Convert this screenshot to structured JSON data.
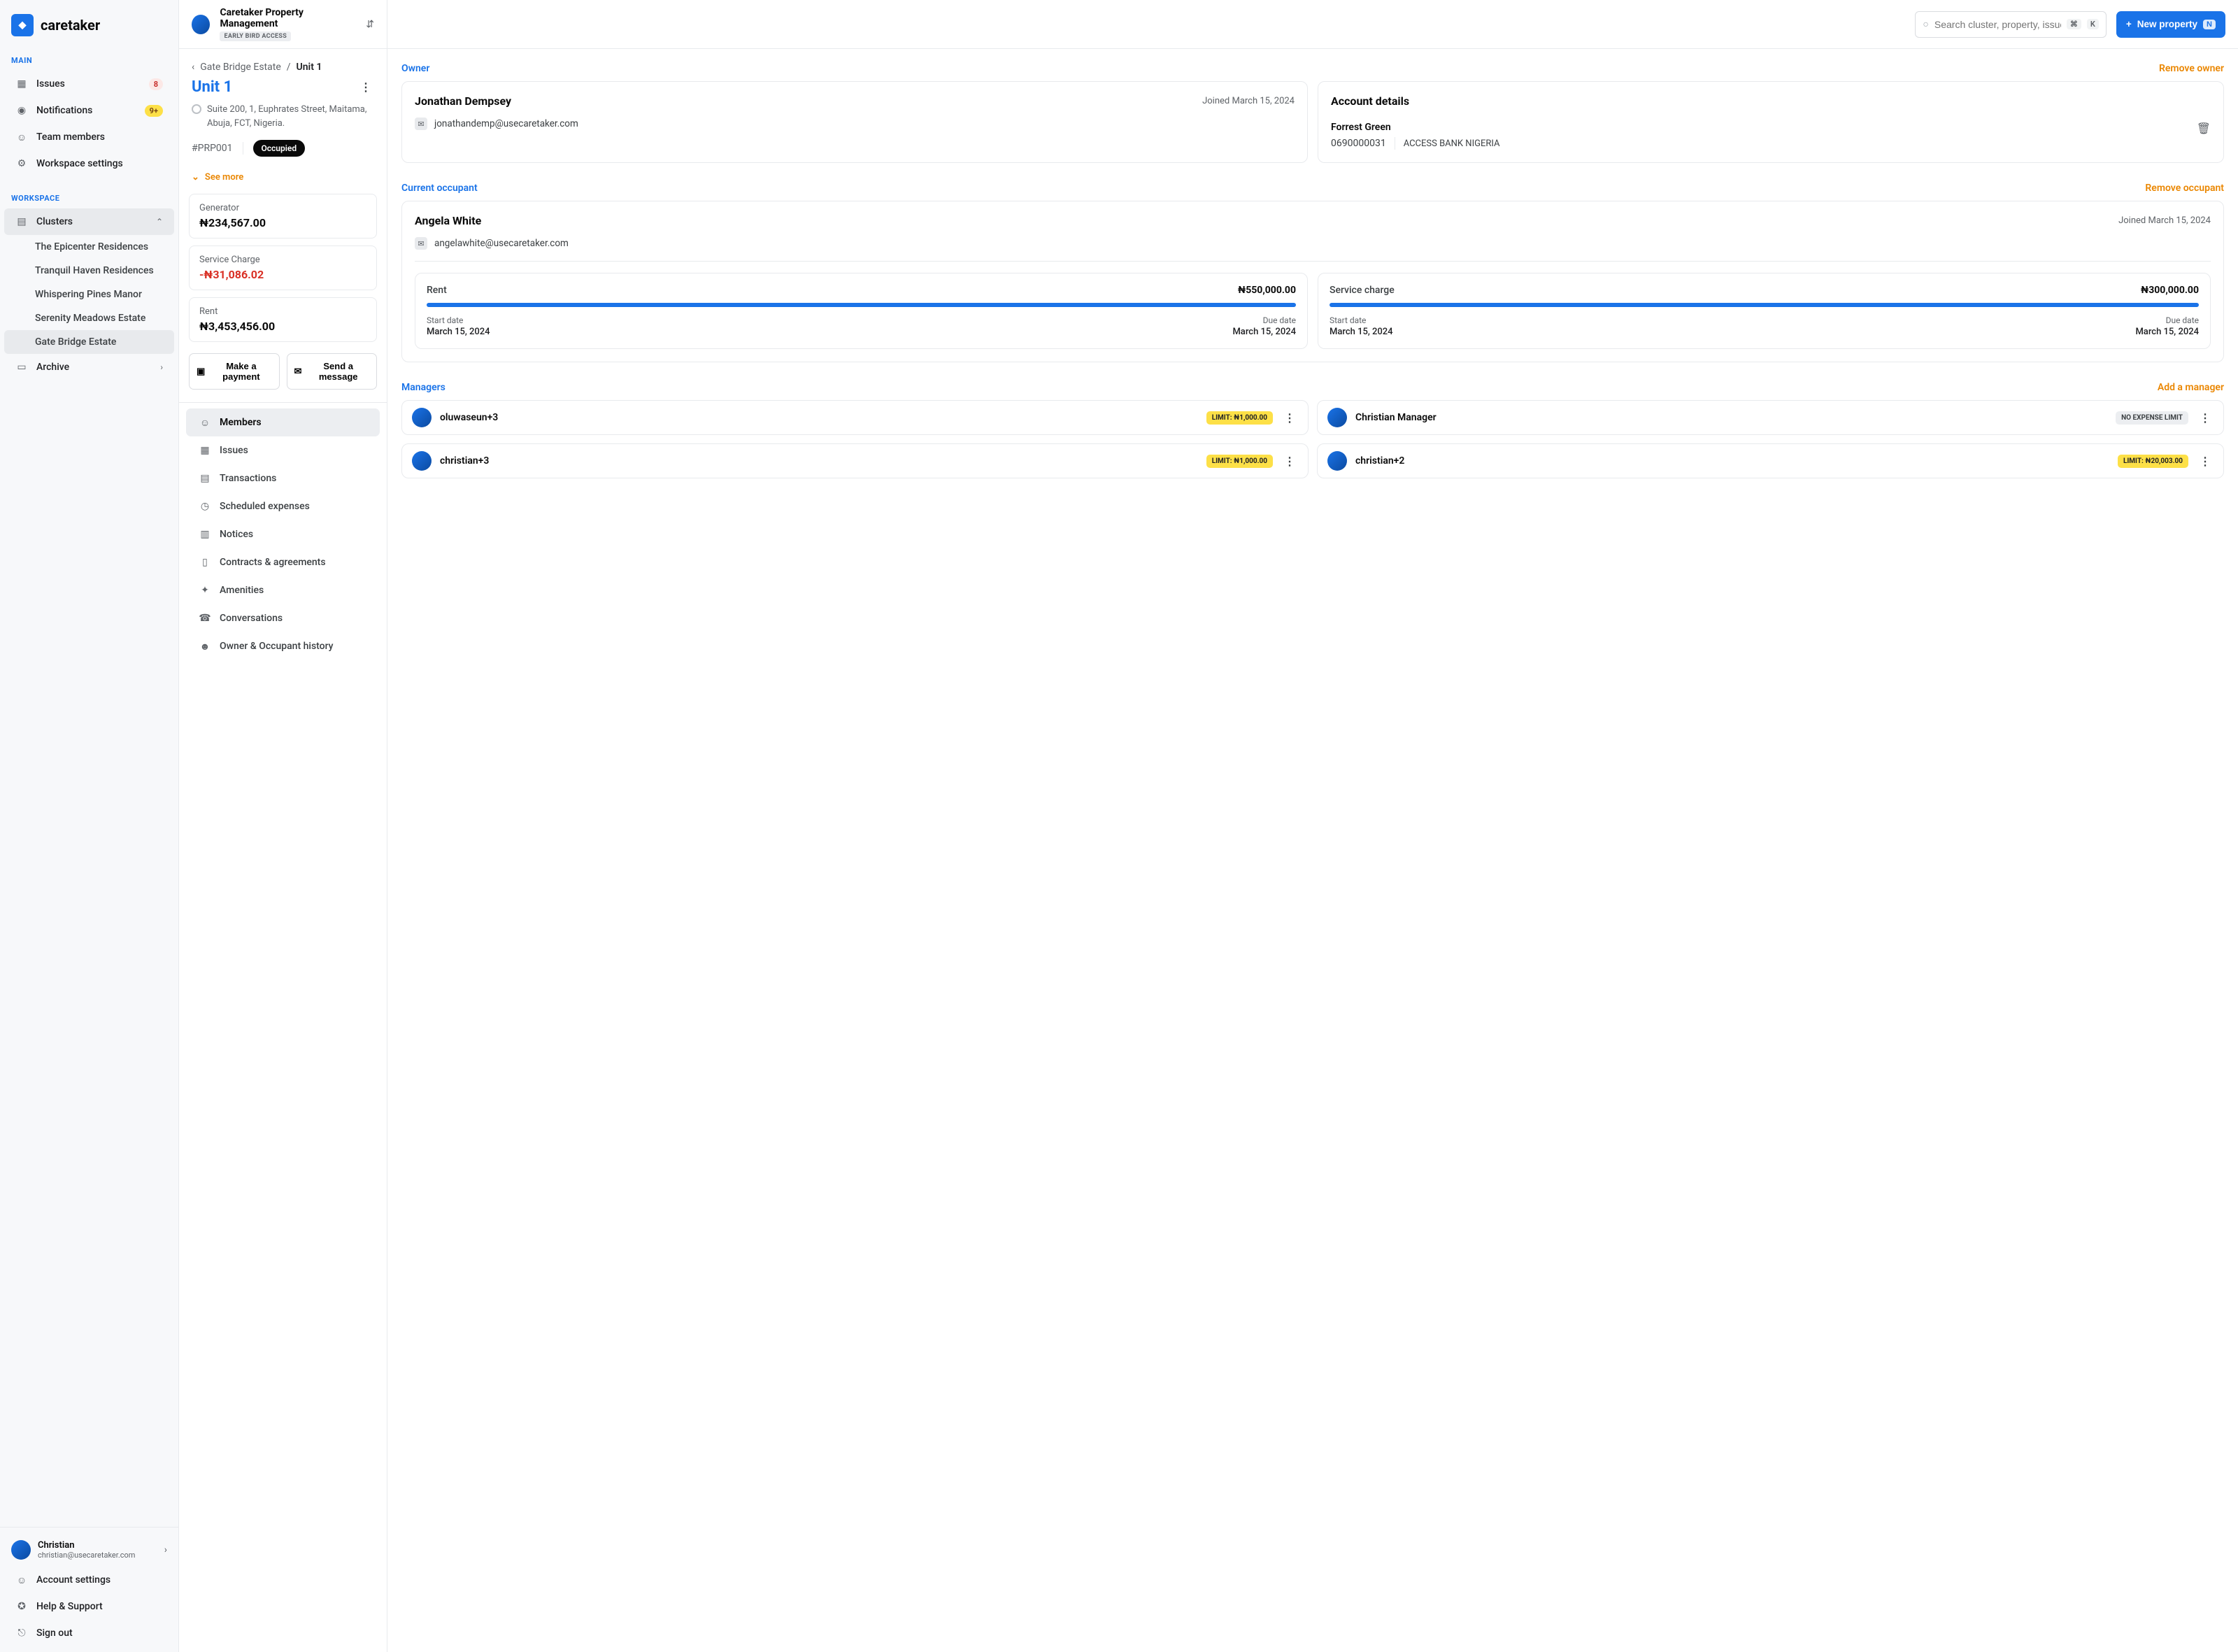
{
  "brand": "caretaker",
  "sidebar": {
    "main_label": "MAIN",
    "workspace_label": "WORKSPACE",
    "items_main": [
      {
        "label": "Issues",
        "badge": "8",
        "badgeClass": "badge-red"
      },
      {
        "label": "Notifications",
        "badge": "9+",
        "badgeClass": "badge-yellow"
      },
      {
        "label": "Team members"
      },
      {
        "label": "Workspace settings"
      }
    ],
    "clusters_label": "Clusters",
    "clusters": [
      "The Epicenter Residences",
      "Tranquil Haven Residences",
      "Whispering Pines Manor",
      "Serenity Meadows Estate",
      "Gate Bridge Estate"
    ],
    "archive_label": "Archive"
  },
  "footer": {
    "user_name": "Christian",
    "user_email": "christian@usecaretaker.com",
    "items": [
      "Account settings",
      "Help & Support",
      "Sign out"
    ]
  },
  "org": {
    "name": "Caretaker Property Management",
    "badge": "EARLY BIRD ACCESS"
  },
  "breadcrumb": {
    "parent": "Gate Bridge Estate",
    "current": "Unit 1"
  },
  "unit": {
    "title": "Unit 1",
    "address": "Suite 200, 1, Euphrates Street, Maitama, Abuja, FCT, Nigeria.",
    "id": "#PRP001",
    "status": "Occupied",
    "see_more": "See more"
  },
  "stats": [
    {
      "label": "Generator",
      "value": "₦234,567.00"
    },
    {
      "label": "Service Charge",
      "value": "-₦31,086.02",
      "neg": true
    },
    {
      "label": "Rent",
      "value": "₦3,453,456.00"
    }
  ],
  "actions": {
    "pay": "Make a payment",
    "msg": "Send a message"
  },
  "midtabs": [
    "Members",
    "Issues",
    "Transactions",
    "Scheduled expenses",
    "Notices",
    "Contracts & agreements",
    "Amenities",
    "Conversations",
    "Owner & Occupant history"
  ],
  "search": {
    "placeholder": "Search cluster, property, issues...",
    "k1": "⌘",
    "k2": "K"
  },
  "newprop": {
    "label": "New property",
    "kbd": "N"
  },
  "owner": {
    "section": "Owner",
    "remove": "Remove owner",
    "name": "Jonathan Dempsey",
    "joined": "Joined March 15, 2024",
    "email": "jonathandemp@usecaretaker.com",
    "account_title": "Account details",
    "acct_name": "Forrest Green",
    "acct_num": "0690000031",
    "bank": "ACCESS BANK NIGERIA"
  },
  "occupant": {
    "section": "Current occupant",
    "remove": "Remove occupant",
    "name": "Angela White",
    "joined": "Joined March 15, 2024",
    "email": "angelawhite@usecaretaker.com",
    "progs": [
      {
        "label": "Rent",
        "amount": "₦550,000.00",
        "start_l": "Start date",
        "start": "March 15, 2024",
        "due_l": "Due date",
        "due": "March 15, 2024"
      },
      {
        "label": "Service charge",
        "amount": "₦300,000.00",
        "start_l": "Start date",
        "start": "March 15, 2024",
        "due_l": "Due date",
        "due": "March 15, 2024"
      }
    ]
  },
  "managers": {
    "section": "Managers",
    "add": "Add a manager",
    "list": [
      {
        "name": "oluwaseun+3",
        "badge": "LIMIT: ₦1,000.00",
        "cls": "lb-yellow",
        "dots": true
      },
      {
        "name": "Christian Manager",
        "badge": "NO EXPENSE LIMIT",
        "cls": "lb-grey",
        "dots": true
      },
      {
        "name": "christian+3",
        "badge": "LIMIT: ₦1,000.00",
        "cls": "lb-yellow",
        "dots": true
      },
      {
        "name": "christian+2",
        "badge": "LIMIT: ₦20,003.00",
        "cls": "lb-yellow",
        "dots": true
      }
    ]
  }
}
